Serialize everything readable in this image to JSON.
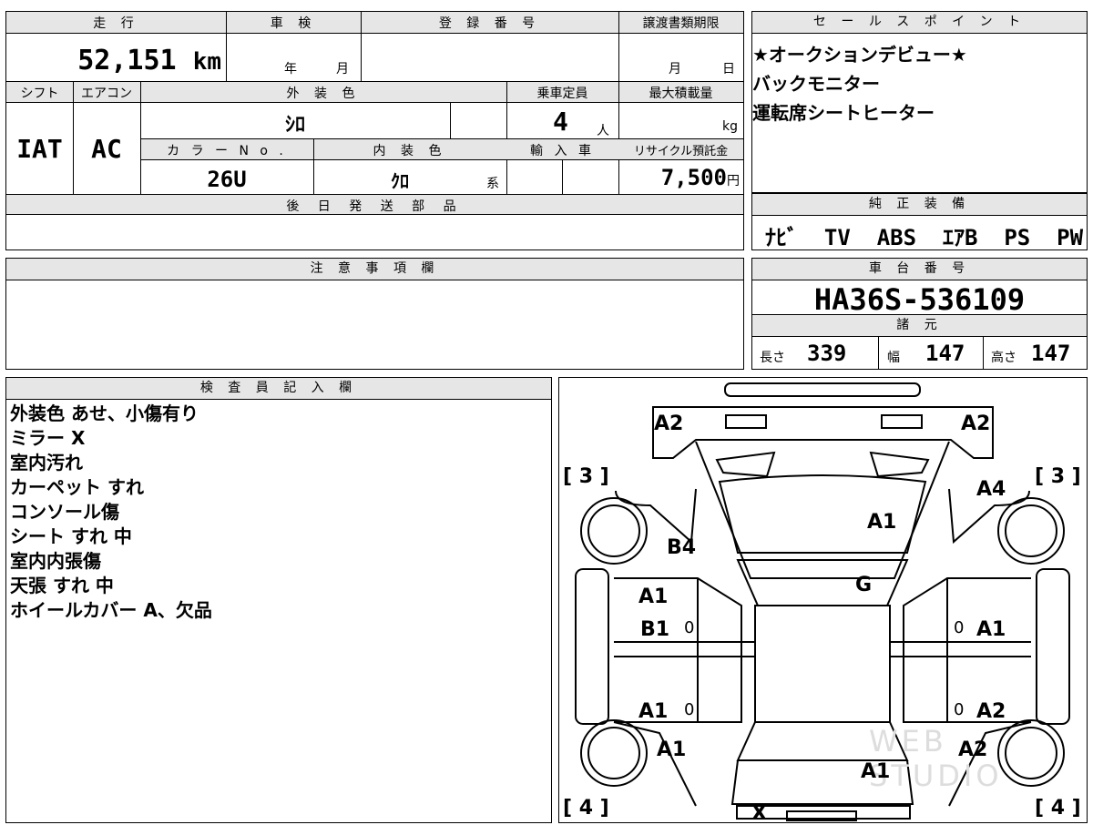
{
  "top": {
    "headers": {
      "mileage": "走 行",
      "inspection": "車 検",
      "reg_number": "登 録 番 号",
      "transfer_deadline": "譲渡書類期限",
      "shift": "シフト",
      "aircon": "エアコン",
      "exterior_color": "外 装 色",
      "capacity": "乗車定員",
      "max_load": "最大積載量",
      "color_no": "カ ラ ー N o .",
      "interior_color": "内 装 色",
      "import": "輸 入 車",
      "recycle": "リサイクル預託金",
      "later_parts": "後 日 発 送 部 品"
    },
    "mileage_value": "52,151",
    "mileage_unit": "km",
    "inspection_year": "年",
    "inspection_month": "月",
    "transfer_month": "月",
    "transfer_day": "日",
    "shift_value": "IAT",
    "aircon_value": "AC",
    "exterior_color_value": "ｼﾛ",
    "capacity_value": "4",
    "capacity_unit": "人",
    "max_load_unit": "kg",
    "color_no_value": "26U",
    "interior_color_value": "ｸﾛ",
    "interior_color_suffix": "系",
    "recycle_value": "7,500",
    "recycle_unit": "円"
  },
  "sales": {
    "header": "セ ー ル ス ポ イ ン ト",
    "lines": [
      "★オークションデビュー★",
      "バックモニター",
      "運転席シートヒーター"
    ]
  },
  "equipment": {
    "header": "純 正 装 備",
    "items": [
      "ﾅﾋﾞ",
      "TV",
      "ABS",
      "ｴｱB",
      "PS",
      "PW"
    ]
  },
  "notes": {
    "header": "注 意 事 項 欄"
  },
  "chassis": {
    "header": "車 台 番 号",
    "value": "HA36S-536109",
    "spec_header": "諸 元",
    "length_label": "長さ",
    "length_value": "339",
    "width_label": "幅",
    "width_value": "147",
    "height_label": "高さ",
    "height_value": "147"
  },
  "inspector": {
    "header": "検 査 員 記 入 欄",
    "lines": [
      "外装色 あせ、小傷有り",
      "ミラー X",
      "室内汚れ",
      "カーペット すれ",
      "コンソール傷",
      "シート すれ 中",
      "室内内張傷",
      "天張 すれ 中",
      "ホイールカバー A、欠品"
    ]
  },
  "diagram": {
    "marks": {
      "front_left": "A2",
      "front_right": "A2",
      "tire_front_left": "[ 3 ]",
      "tire_front_right": "[ 3 ]",
      "right_fender": "A4",
      "bonnet": "A1",
      "left_fender": "B4",
      "windshield": "G",
      "left_front_door_1": "A1",
      "left_front_door_2": "B1",
      "right_front_door": "A1",
      "left_rear_door": "A1",
      "right_rear_door": "A2",
      "left_quarter": "A1",
      "right_quarter": "A2",
      "rear_hatch": "A1",
      "tire_rear_left": "[ 4 ]",
      "tire_rear_right": "[ 4 ]",
      "rear_bumper": "X",
      "zero_1": "0",
      "zero_2": "0",
      "zero_3": "0",
      "zero_4": "0"
    },
    "watermark": "WEB STUDIO"
  }
}
